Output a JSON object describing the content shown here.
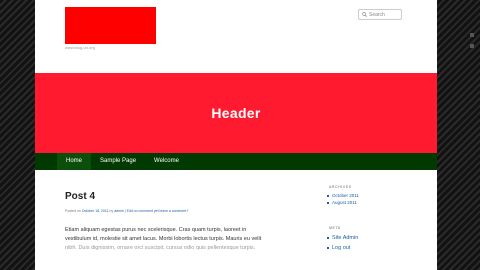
{
  "site": {
    "url": "www.blog-url.org",
    "search_placeholder": "Search"
  },
  "hero": {
    "title": "Header"
  },
  "nav": {
    "items": [
      {
        "label": "Home"
      },
      {
        "label": "Sample Page"
      },
      {
        "label": "Welcome"
      }
    ]
  },
  "post": {
    "title": "Post 4",
    "meta": {
      "prefix": "Posted on",
      "date": "October 18, 2011",
      "by": "by",
      "author": "admin",
      "sep": "|",
      "edit": "Edit no comment yet",
      "comment": "leave a comment?"
    },
    "body_lines": [
      "Etiam aliquam egestas purus nec scelerisque. Cras quam turpis, laoreet in",
      "vestibulum id, molestie sit amet lacus. Morbi lobortis lectus turpis. Mauris eu velit",
      "nibh. Duis dignissim, ornare orci suscipit, cursus odio quis pellentesque turpis."
    ]
  },
  "sidebar": {
    "archives": {
      "title": "ARCHIVES",
      "items": [
        "October 2011",
        "August 2011"
      ]
    },
    "meta": {
      "title": "META",
      "items": [
        "Site Admin",
        "Log out"
      ]
    }
  }
}
